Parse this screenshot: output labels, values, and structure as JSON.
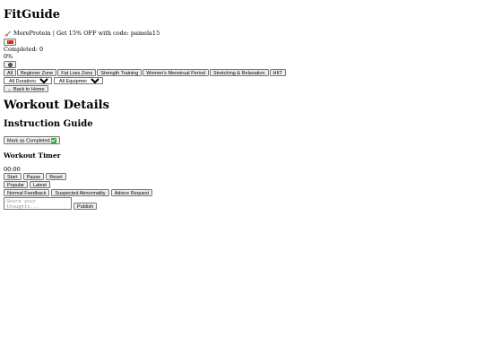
{
  "app": {
    "title": "FitGuide"
  },
  "promo": {
    "text": "MoreProtein | Get 15% OFF with code: pamela15",
    "icon": "rocket-icon"
  },
  "language": {
    "icon": "china-flag-icon"
  },
  "progress": {
    "completed_label": "Completed: 0",
    "percent_label": "0%"
  },
  "theme": {
    "icon": "moon-icon"
  },
  "categories": [
    {
      "label": "All"
    },
    {
      "label": "Beginner Zone"
    },
    {
      "label": "Fat Loss Zone"
    },
    {
      "label": "Strength Training"
    },
    {
      "label": "Women's Menstrual Period"
    },
    {
      "label": "Stretching & Relaxation"
    },
    {
      "label": "HIIT"
    }
  ],
  "filters": {
    "duration_selected": "All Durations",
    "equipment_selected": "All Equipment"
  },
  "nav": {
    "back_label": "← Back to Home"
  },
  "details": {
    "title": "Workout Details",
    "guide_title": "Instruction Guide",
    "mark_completed_label": "Mark as Completed"
  },
  "timer": {
    "title": "Workout Timer",
    "display": "00:00",
    "start_label": "Start",
    "pause_label": "Pause",
    "reset_label": "Reset"
  },
  "comments": {
    "sort": [
      {
        "label": "Popular"
      },
      {
        "label": "Latest"
      }
    ],
    "tags": [
      {
        "label": "Normal Feedback"
      },
      {
        "label": "Suspected Abnormality"
      },
      {
        "label": "Advice Request"
      }
    ],
    "placeholder": "Share your thoughts...",
    "publish_label": "Publish"
  }
}
